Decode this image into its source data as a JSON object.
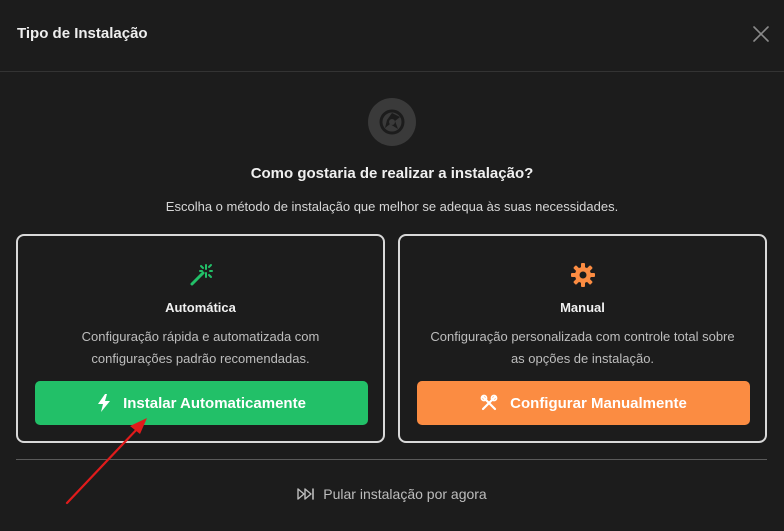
{
  "header": {
    "title": "Tipo de Instalação"
  },
  "main": {
    "question": "Como gostaria de realizar a instalação?",
    "subtitle": "Escolha o método de instalação que melhor se adequa às suas necessidades."
  },
  "options": [
    {
      "title": "Automática",
      "description_line1": "Configuração rápida e automatizada com",
      "description_line2": "configurações padrão recomendadas.",
      "button_label": "Instalar Automaticamente",
      "icon": "magic-wand-icon",
      "button_icon": "bolt-icon",
      "accent": "#22c068"
    },
    {
      "title": "Manual",
      "description_line1": "Configuração personalizada com controle total sobre",
      "description_line2": "as opções de instalação.",
      "button_label": "Configurar Manualmente",
      "icon": "gear-icon",
      "button_icon": "tools-icon",
      "accent": "#fb8c42"
    }
  ],
  "footer": {
    "skip_label": "Pular instalação por agora",
    "skip_icon": "fast-forward-icon"
  },
  "colors": {
    "background": "#1c1c1c",
    "annotation_arrow": "#e01b1b"
  }
}
